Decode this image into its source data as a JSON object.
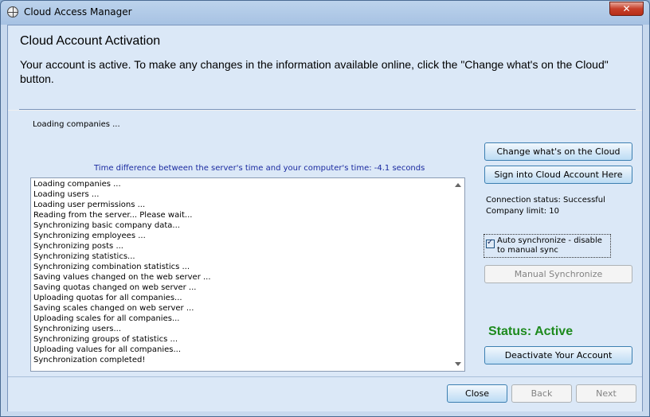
{
  "window": {
    "title": "Cloud Access Manager",
    "close_label": "✕"
  },
  "header": {
    "title": "Cloud Account Activation",
    "description": "Your account is active. To make any changes in the information available online, click the \"Change what's on the Cloud\" button."
  },
  "main": {
    "loading_text": "Loading companies ...",
    "time_difference": "Time difference between the server's time and your computer's time: -4.1 seconds",
    "log_lines": [
      "Loading companies ...",
      "Loading users ...",
      "Loading user permissions ...",
      "Reading from the server... Please wait...",
      "Synchronizing basic company data...",
      "Synchronizing employees ...",
      "Synchronizing posts ...",
      "Synchronizing statistics...",
      "Synchronizing combination statistics ...",
      "Saving values changed on the web server ...",
      "Saving quotas changed on web server ...",
      "Uploading quotas for all companies...",
      "Saving scales changed on web server ...",
      "Uploading scales for all companies...",
      "Synchronizing users...",
      "Synchronizing groups of statistics ...",
      "Uploading values for all companies...",
      "Synchronization completed!"
    ]
  },
  "side": {
    "change_button": "Change what's on the Cloud",
    "sign_in_button": "Sign into Cloud Account Here",
    "connection_status": "Connection status: Successful",
    "company_limit": "Company limit: 10",
    "auto_sync_label": "Auto synchronize - disable to manual sync",
    "auto_sync_checked": true,
    "manual_sync_button": "Manual Synchronize",
    "status_text": "Status: Active",
    "status_color": "#1d8a1d",
    "deactivate_button": "Deactivate Your Account"
  },
  "footer": {
    "close_button": "Close",
    "back_button": "Back",
    "next_button": "Next"
  }
}
